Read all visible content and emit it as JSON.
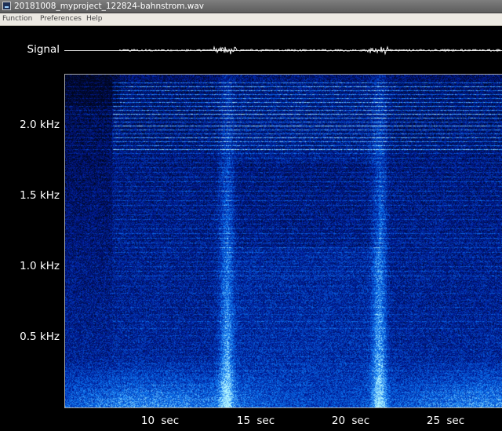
{
  "window": {
    "title": "20181008_myproject_122824-bahnstrom.wav"
  },
  "menu": {
    "items": [
      "Function",
      "Preferences",
      "Help"
    ]
  },
  "signal": {
    "label": "Signal"
  },
  "spectrogram": {
    "y_labels": [
      "2.0 kHz",
      "1.5 kHz",
      "1.0 kHz",
      "0.5 kHz"
    ],
    "x_labels": [
      "10  sec",
      "15  sec",
      "20  sec",
      "25  sec"
    ],
    "colors": {
      "background": "#000000",
      "low": "#00082a",
      "mid": "#1a4cc8",
      "high": "#38d6ff",
      "peak": "#b8f4ff"
    }
  }
}
